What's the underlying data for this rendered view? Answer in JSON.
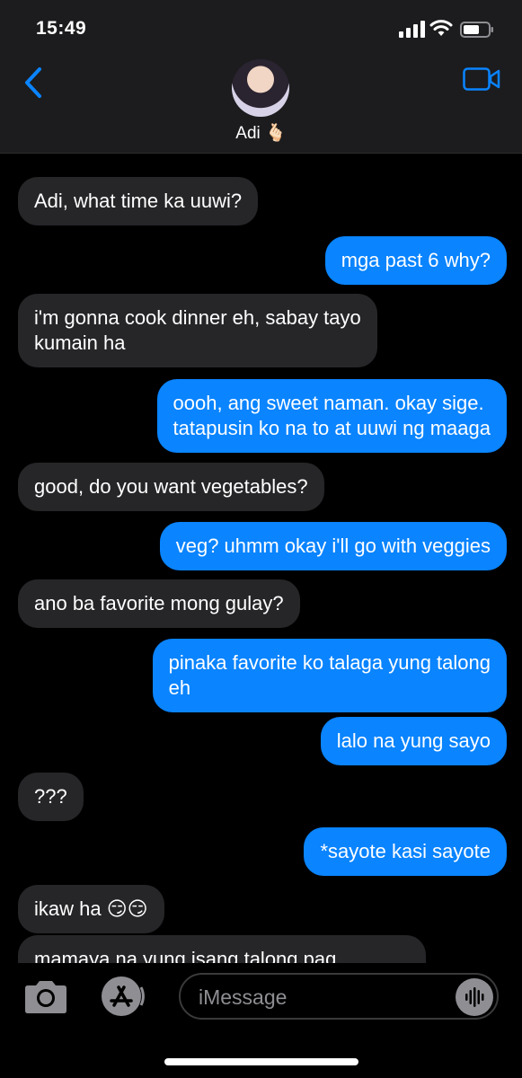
{
  "status_bar": {
    "time": "15:49"
  },
  "header": {
    "contact_name": "Adi 🫰🏻"
  },
  "messages": [
    {
      "dir": "in",
      "text": "Adi, what time ka uuwi?"
    },
    {
      "dir": "out",
      "text": "mga past 6 why?"
    },
    {
      "dir": "in",
      "text": "i'm gonna cook dinner eh, sabay tayo\nkumain ha"
    },
    {
      "dir": "out",
      "text": "oooh, ang sweet naman. okay sige.\ntatapusin ko na to at uuwi ng maaga"
    },
    {
      "dir": "in",
      "text": "good, do you want vegetables?"
    },
    {
      "dir": "out",
      "text": "veg? uhmm okay i'll go with veggies"
    },
    {
      "dir": "in",
      "text": "ano ba favorite mong gulay?"
    },
    {
      "dir": "out",
      "text": "pinaka favorite ko talaga yung talong\neh"
    },
    {
      "dir": "out",
      "text": "lalo na yung sayo"
    },
    {
      "dir": "in",
      "text": "???"
    },
    {
      "dir": "out",
      "text": "*sayote kasi sayote"
    },
    {
      "dir": "in",
      "text": "ikaw ha 😏😏"
    },
    {
      "dir": "in",
      "text": "mamaya na yung isang talong pag"
    }
  ],
  "composer": {
    "placeholder": "iMessage"
  }
}
